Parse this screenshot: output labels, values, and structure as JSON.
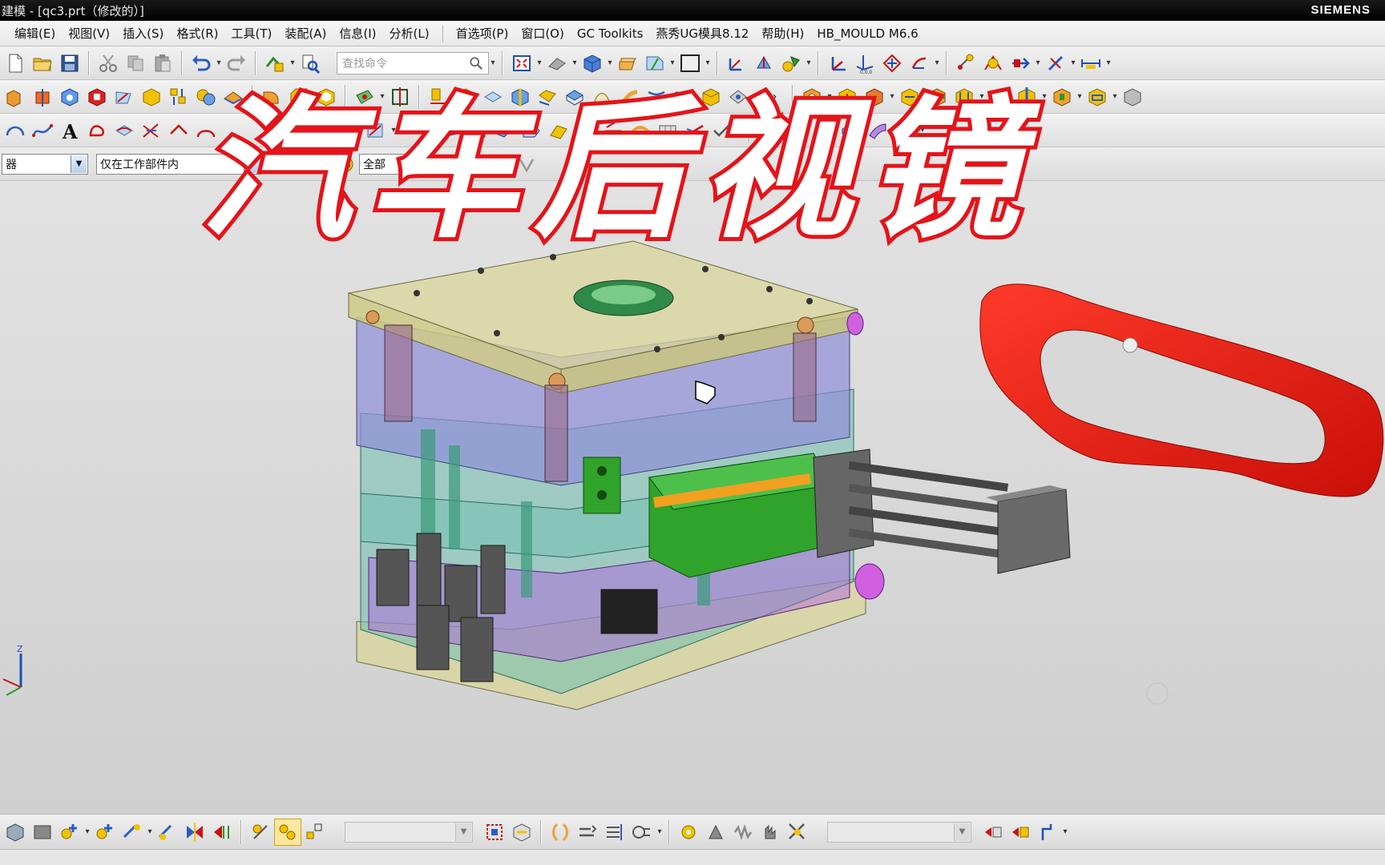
{
  "window": {
    "title": "建模 - [qc3.prt（修改的）]",
    "brand": "SIEMENS"
  },
  "menu": {
    "items": [
      "编辑(E)",
      "视图(V)",
      "插入(S)",
      "格式(R)",
      "工具(T)",
      "装配(A)",
      "信息(I)",
      "分析(L)",
      "首选项(P)",
      "窗口(O)",
      "GC Toolkits",
      "燕秀UG模具8.12",
      "帮助(H)",
      "HB_MOULD M6.6"
    ]
  },
  "toolbar": {
    "search_placeholder": "查找命令"
  },
  "selection_bar": {
    "filter_value": "器",
    "scope_value": "仅在工作部件内",
    "type_value": "全部"
  },
  "overlay": {
    "title": "汽车后视镜"
  },
  "axis_triad": {
    "z_label": "Z"
  },
  "colors": {
    "overlay_stroke": "#e4141a",
    "part_red": "#e81d10",
    "plate_yellow": "#d9d59a",
    "plate_purple": "#8f8fd8",
    "plate_teal": "#6fbfb0",
    "slider_green": "#2fa32a"
  }
}
